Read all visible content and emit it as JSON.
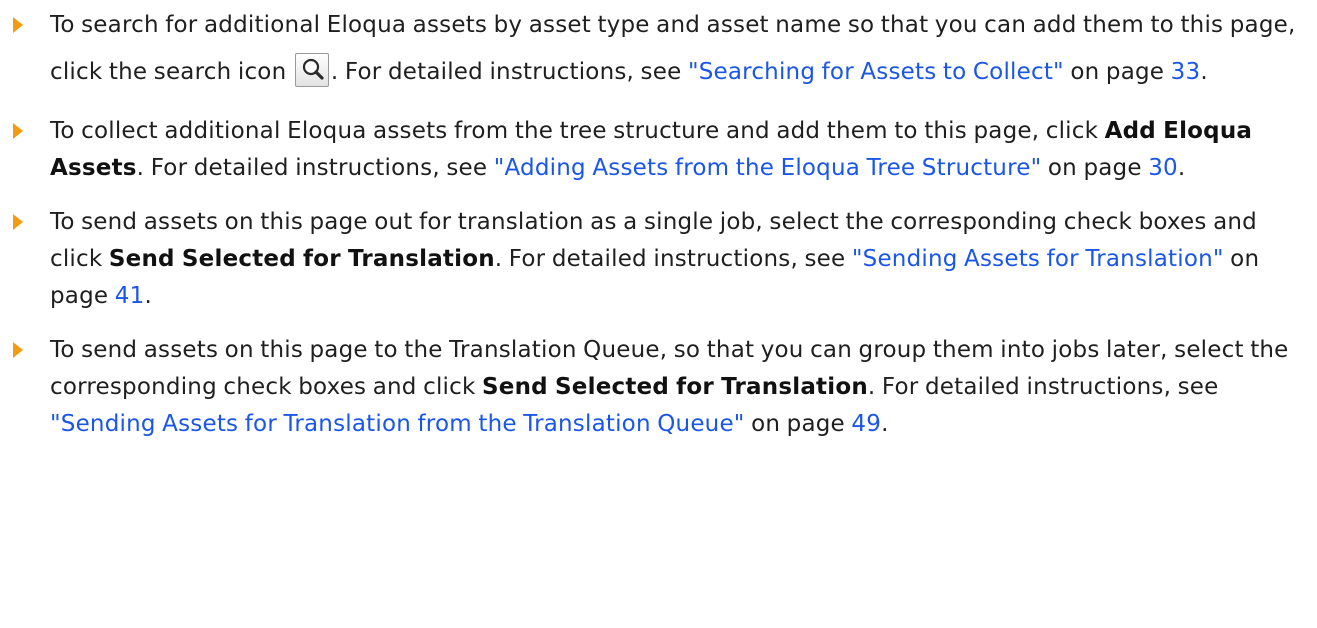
{
  "items": [
    {
      "t1": "To search for additional Eloqua assets by asset type and asset name so that you can add them to this page, click the search icon",
      "icon": "search-icon",
      "t2": ". For detailed instructions, see ",
      "link": "\"Searching for Assets to Collect\"",
      "t3": " on page ",
      "page": "33",
      "t4": "."
    },
    {
      "t1": "To collect additional Eloqua assets from the tree structure and add them to this page, click ",
      "bold": "Add Eloqua Assets",
      "t2": ". For detailed instructions, see ",
      "link": "\"Adding Assets from the Eloqua Tree Structure\"",
      "t3": " on page ",
      "page": "30",
      "t4": "."
    },
    {
      "t1": "To send assets on this page out for translation as a single job, select the corresponding check boxes and click ",
      "bold": "Send Selected for Translation",
      "t2": ". For detailed instructions, see ",
      "link": "\"Sending Assets for Translation\"",
      "t3": " on page ",
      "page": "41",
      "t4": "."
    },
    {
      "t1": "To send assets on this page to the Translation Queue, so that you can group them into jobs later, select the corresponding check boxes and click ",
      "bold": "Send Selected for Translation",
      "t2": ". For detailed instructions, see ",
      "link": "\"Sending Assets for Translation from the Translation Queue\"",
      "t3": " on page ",
      "page": "49",
      "t4": "."
    }
  ],
  "colors": {
    "bullet": "#f39c12",
    "link": "#1a56e8",
    "text": "#1f1f1f"
  }
}
